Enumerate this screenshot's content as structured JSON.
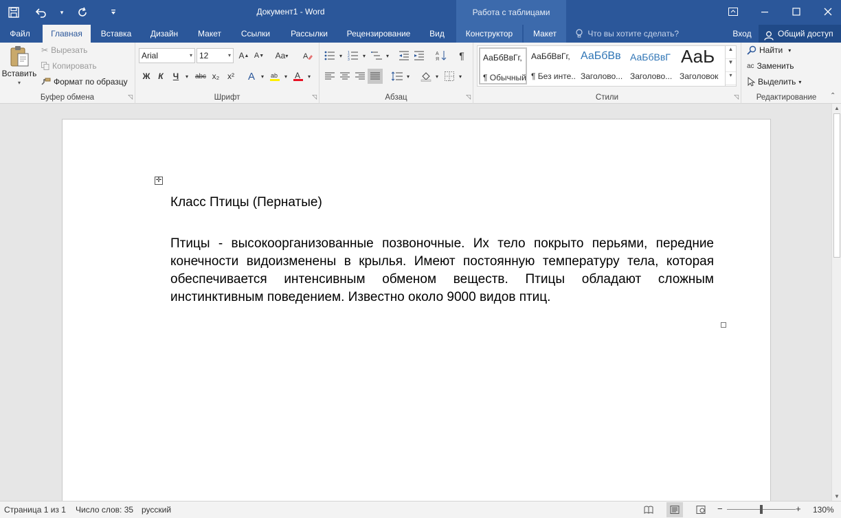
{
  "app": {
    "title": "Документ1 - Word",
    "context_group": "Работа с таблицами",
    "quick_access": {
      "save": "save-icon",
      "undo": "undo-icon",
      "redo": "redo-icon",
      "customize": "customize-icon"
    }
  },
  "tabs": [
    {
      "label": "Файл"
    },
    {
      "label": "Главная"
    },
    {
      "label": "Вставка"
    },
    {
      "label": "Дизайн"
    },
    {
      "label": "Макет"
    },
    {
      "label": "Ссылки"
    },
    {
      "label": "Рассылки"
    },
    {
      "label": "Рецензирование"
    },
    {
      "label": "Вид"
    },
    {
      "label": "Конструктор"
    },
    {
      "label": "Макет"
    }
  ],
  "active_tab": "Главная",
  "tell_me": "Что вы хотите сделать?",
  "sign_in": "Вход",
  "share": "Общий доступ",
  "ribbon": {
    "clipboard": {
      "label": "Буфер обмена",
      "paste": "Вставить",
      "cut": "Вырезать",
      "copy": "Копировать",
      "format_painter": "Формат по образцу"
    },
    "font": {
      "label": "Шрифт",
      "font_name": "Arial",
      "font_size": "12",
      "aa": "Aa",
      "bold": "Ж",
      "italic": "К",
      "underline": "Ч",
      "strike": "abc",
      "sub": "x₂",
      "sup": "x²"
    },
    "paragraph": {
      "label": "Абзац"
    },
    "styles": {
      "label": "Стили",
      "items": [
        {
          "preview": "АаБбВвГг,",
          "name": "¶ Обычный"
        },
        {
          "preview": "АаБбВвГг,",
          "name": "¶ Без инте..."
        },
        {
          "preview": "АаБбВв",
          "name": "Заголово..."
        },
        {
          "preview": "АаБбВвГ",
          "name": "Заголово..."
        },
        {
          "preview": "АаЬ",
          "name": "Заголовок"
        }
      ]
    },
    "editing": {
      "label": "Редактирование",
      "find": "Найти",
      "replace": "Заменить",
      "select": "Выделить"
    }
  },
  "document": {
    "heading": "Класс Птицы (Пернатые)",
    "body": "Птицы - высокоорганизованные позвоночные. Их тело покрыто перьями, передние конечности видоизменены в крылья. Имеют постоянную температуру тела, которая обеспечивается интенсивным обменом веществ. Птицы обладают сложным инстинктивным поведением. Известно около 9000 видов птиц."
  },
  "status": {
    "page": "Страница 1 из 1",
    "words": "Число слов: 35",
    "language": "русский",
    "zoom": "130%"
  },
  "colors": {
    "accent": "#2b579a",
    "context_tab": "#3c6aac",
    "page": "#ffffff",
    "canvas": "#e6e6e6"
  }
}
